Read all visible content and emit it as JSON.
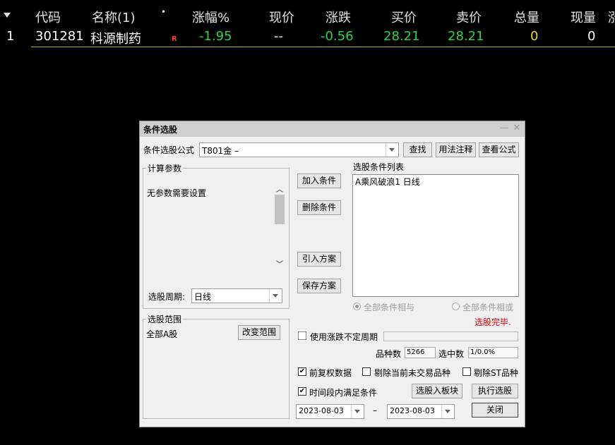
{
  "table": {
    "headers": [
      "代码",
      "名称(1)",
      "•",
      "涨幅%",
      "现价",
      "涨跌",
      "买价",
      "卖价",
      "总量",
      "现量",
      "涨"
    ],
    "row": {
      "index": "1",
      "code": "301281",
      "name": "科源制药",
      "flag": "R",
      "change_pct": "-1.95",
      "price": "--",
      "change": "-0.56",
      "bid": "28.21",
      "ask": "28.21",
      "volume": "0",
      "cur_volume": "0"
    }
  },
  "dialog": {
    "title": "条件选股",
    "formula_label": "条件选股公式",
    "formula_value": "T801金  –",
    "find_button": "查找",
    "usage_button": "用法注释",
    "view_formula_button": "查看公式",
    "params_group": "计算参数",
    "params_text": "无参数需要设置",
    "period_label": "选股周期:",
    "period_value": "日线",
    "range_group": "选股范围",
    "range_value": "全部A股",
    "change_range_button": "改变范围",
    "add_condition_button": "加入条件",
    "delete_condition_button": "删除条件",
    "import_plan_button": "引入方案",
    "save_plan_button": "保存方案",
    "condition_list_label": "选股条件列表",
    "conditions": [
      "A乘风破浪1 日线"
    ],
    "radio_and": "全部条件相与",
    "radio_or": "全部条件相或",
    "status": "选股完毕.",
    "use_uncertain_period": "使用涨跌不定周期",
    "stock_count_label": "品种数",
    "stock_count_value": "5266",
    "selected_label": "选中数",
    "selected_value": "1/0.0%",
    "pre_adjust": "前复权数据",
    "exclude_untraded": "剔除当前未交易品种",
    "exclude_st": "剔除ST品种",
    "time_range_satisfy": "时间段内满足条件",
    "to_block_button": "选股入板块",
    "execute_button": "执行选股",
    "date_from": "2023-08-03",
    "date_sep": "–",
    "date_to": "2023-08-03",
    "close_button": "关闭"
  },
  "colors": {
    "background": "#000000",
    "text_white": "#ffffff",
    "value_green": "#2fd24a",
    "value_yellow": "#e3df24",
    "flag_red": "#ff3a3a",
    "dialog_bg": "#f0f0f0",
    "status_red": "#e00000"
  }
}
